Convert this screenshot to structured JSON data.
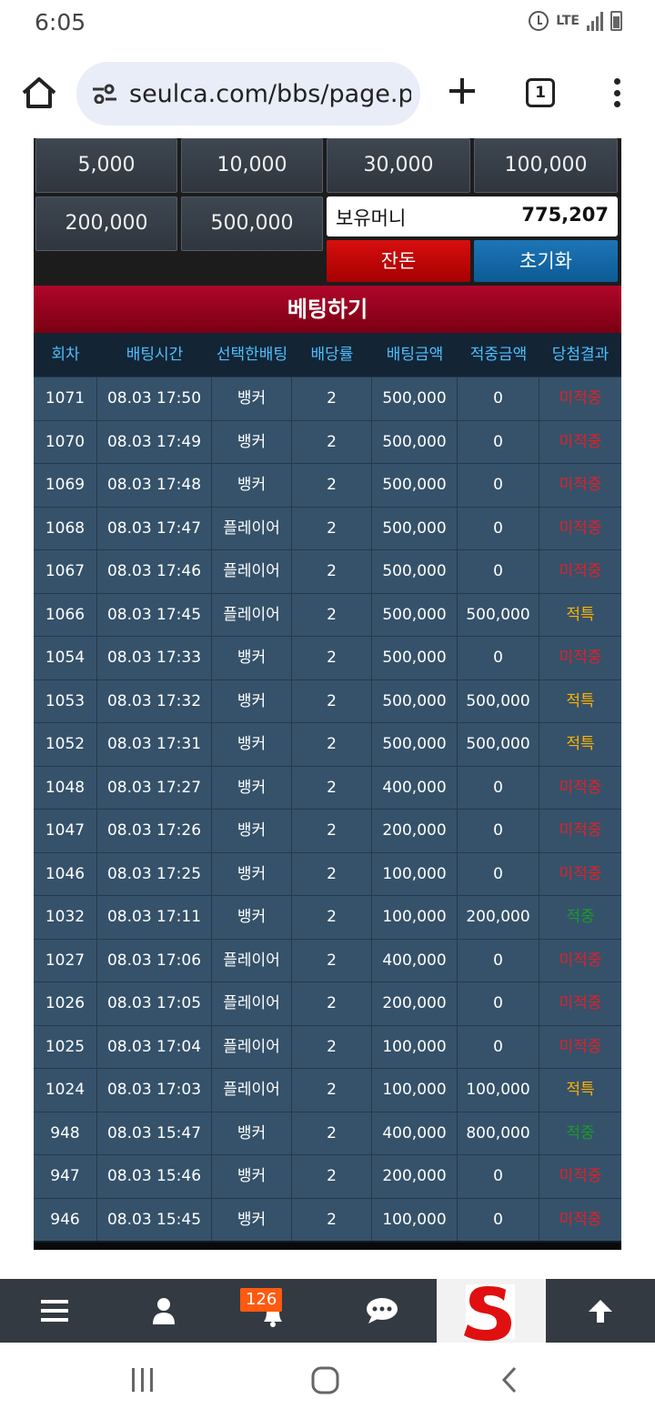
{
  "status_bar": {
    "time": "6:05",
    "network": "LTE"
  },
  "browser": {
    "url": "seulca.com/bbs/page.p",
    "tab_count": "1"
  },
  "bet_panel": {
    "chips": [
      "5,000",
      "10,000",
      "30,000",
      "100,000",
      "200,000",
      "500,000"
    ],
    "balance_label": "보유머니",
    "balance_value": "775,207",
    "change_button": "잔돈",
    "reset_button": "초기화"
  },
  "bet_section_title": "베팅하기",
  "table": {
    "headers": [
      "회차",
      "배팅시간",
      "선택한배팅",
      "배당률",
      "배팅금액",
      "적중금액",
      "당첨결과"
    ],
    "rows": [
      [
        "1071",
        "08.03 17:50",
        "뱅커",
        "2",
        "500,000",
        "0",
        "미적중"
      ],
      [
        "1070",
        "08.03 17:49",
        "뱅커",
        "2",
        "500,000",
        "0",
        "미적중"
      ],
      [
        "1069",
        "08.03 17:48",
        "뱅커",
        "2",
        "500,000",
        "0",
        "미적중"
      ],
      [
        "1068",
        "08.03 17:47",
        "플레이어",
        "2",
        "500,000",
        "0",
        "미적중"
      ],
      [
        "1067",
        "08.03 17:46",
        "플레이어",
        "2",
        "500,000",
        "0",
        "미적중"
      ],
      [
        "1066",
        "08.03 17:45",
        "플레이어",
        "2",
        "500,000",
        "500,000",
        "적특"
      ],
      [
        "1054",
        "08.03 17:33",
        "뱅커",
        "2",
        "500,000",
        "0",
        "미적중"
      ],
      [
        "1053",
        "08.03 17:32",
        "뱅커",
        "2",
        "500,000",
        "500,000",
        "적특"
      ],
      [
        "1052",
        "08.03 17:31",
        "뱅커",
        "2",
        "500,000",
        "500,000",
        "적특"
      ],
      [
        "1048",
        "08.03 17:27",
        "뱅커",
        "2",
        "400,000",
        "0",
        "미적중"
      ],
      [
        "1047",
        "08.03 17:26",
        "뱅커",
        "2",
        "200,000",
        "0",
        "미적중"
      ],
      [
        "1046",
        "08.03 17:25",
        "뱅커",
        "2",
        "100,000",
        "0",
        "미적중"
      ],
      [
        "1032",
        "08.03 17:11",
        "뱅커",
        "2",
        "100,000",
        "200,000",
        "적중"
      ],
      [
        "1027",
        "08.03 17:06",
        "플레이어",
        "2",
        "400,000",
        "0",
        "미적중"
      ],
      [
        "1026",
        "08.03 17:05",
        "플레이어",
        "2",
        "200,000",
        "0",
        "미적중"
      ],
      [
        "1025",
        "08.03 17:04",
        "플레이어",
        "2",
        "100,000",
        "0",
        "미적중"
      ],
      [
        "1024",
        "08.03 17:03",
        "플레이어",
        "2",
        "100,000",
        "100,000",
        "적특"
      ],
      [
        "948",
        "08.03 15:47",
        "뱅커",
        "2",
        "400,000",
        "800,000",
        "적중"
      ],
      [
        "947",
        "08.03 15:46",
        "뱅커",
        "2",
        "200,000",
        "0",
        "미적중"
      ],
      [
        "946",
        "08.03 15:45",
        "뱅커",
        "2",
        "100,000",
        "0",
        "미적중"
      ]
    ],
    "result_colors": {
      "미적중": "#e0202a",
      "적특": "#ffb100",
      "적중": "#1a9a2a"
    }
  },
  "site_nav": {
    "notification_count": "126",
    "items": [
      "menu-icon",
      "user-icon",
      "bell-icon",
      "chat-icon",
      "site-logo",
      "arrow-up-icon"
    ]
  },
  "colors": {
    "header_red": "#9b0420",
    "table_row": "#35526a",
    "header_text": "#4cc0ff"
  }
}
